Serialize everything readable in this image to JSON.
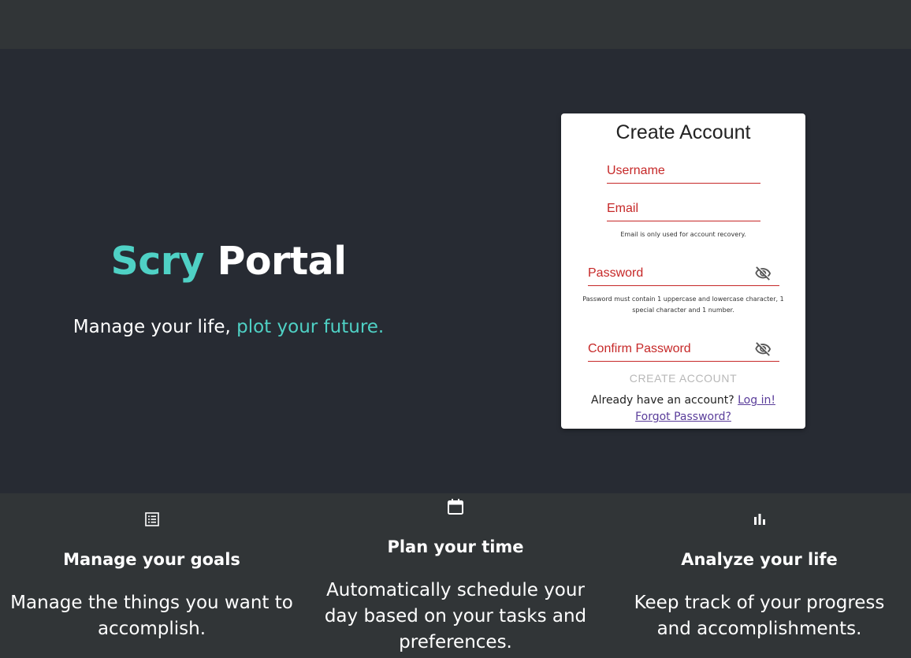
{
  "brand": {
    "accent_word": "Scry",
    "rest": "Portal"
  },
  "tagline": {
    "plain": "Manage your life, ",
    "accent": "plot your future."
  },
  "signup": {
    "title": "Create Account",
    "username_placeholder": "Username",
    "email_placeholder": "Email",
    "email_helper": "Email is only used for account recovery.",
    "password_placeholder": "Password",
    "password_helper": "Password must contain 1 uppercase and lowercase character, 1 special character and 1 number.",
    "confirm_placeholder": "Confirm Password",
    "create_button": "CREATE ACCOUNT",
    "login_prompt": "Already have an account?",
    "login_link": "Log in!",
    "forgot_link": "Forgot Password?"
  },
  "features": [
    {
      "icon": "list-icon",
      "title": "Manage your goals",
      "text": "Manage the things you want to accomplish."
    },
    {
      "icon": "calendar-icon",
      "title": "Plan your time",
      "text": "Automatically schedule your day based on your tasks and preferences."
    },
    {
      "icon": "bar-chart-icon",
      "title": "Analyze your life",
      "text": "Keep track of your progress and accomplishments."
    }
  ],
  "colors": {
    "accent": "#4fd1c5",
    "background": "#272b33",
    "panel": "#313537",
    "error": "#c62828"
  }
}
